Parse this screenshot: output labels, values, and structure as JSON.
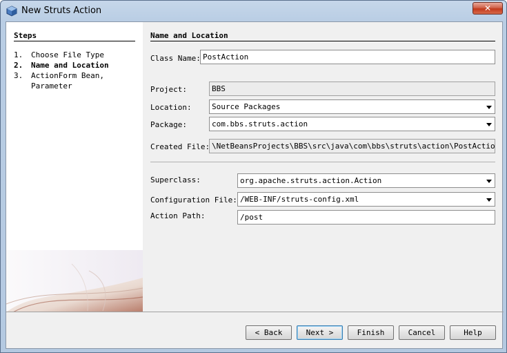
{
  "window": {
    "title": "New Struts Action"
  },
  "steps": {
    "heading": "Steps",
    "items": [
      {
        "num": "1.",
        "label": "Choose File Type"
      },
      {
        "num": "2.",
        "label": "Name and Location"
      },
      {
        "num": "3.",
        "label": "ActionForm Bean,",
        "label2": "Parameter"
      }
    ]
  },
  "form": {
    "heading": "Name and Location",
    "class_name_label": "Class Name:",
    "class_name_value": "PostAction",
    "project_label": "Project:",
    "project_value": "BBS",
    "location_label": "Location:",
    "location_value": "Source Packages",
    "package_label": "Package:",
    "package_value": "com.bbs.struts.action",
    "created_file_label": "Created File:",
    "created_file_value": "\\NetBeansProjects\\BBS\\src\\java\\com\\bbs\\struts\\action\\PostAction.java",
    "superclass_label": "Superclass:",
    "superclass_value": "org.apache.struts.action.Action",
    "config_file_label": "Configuration File:",
    "config_file_value": "/WEB-INF/struts-config.xml",
    "action_path_label": "Action Path:",
    "action_path_value": "/post"
  },
  "buttons": {
    "back": "< Back",
    "next": "Next >",
    "finish": "Finish",
    "cancel": "Cancel",
    "help": "Help"
  },
  "icons": {
    "app": "netbeans-cube-icon",
    "close": "close-icon"
  }
}
